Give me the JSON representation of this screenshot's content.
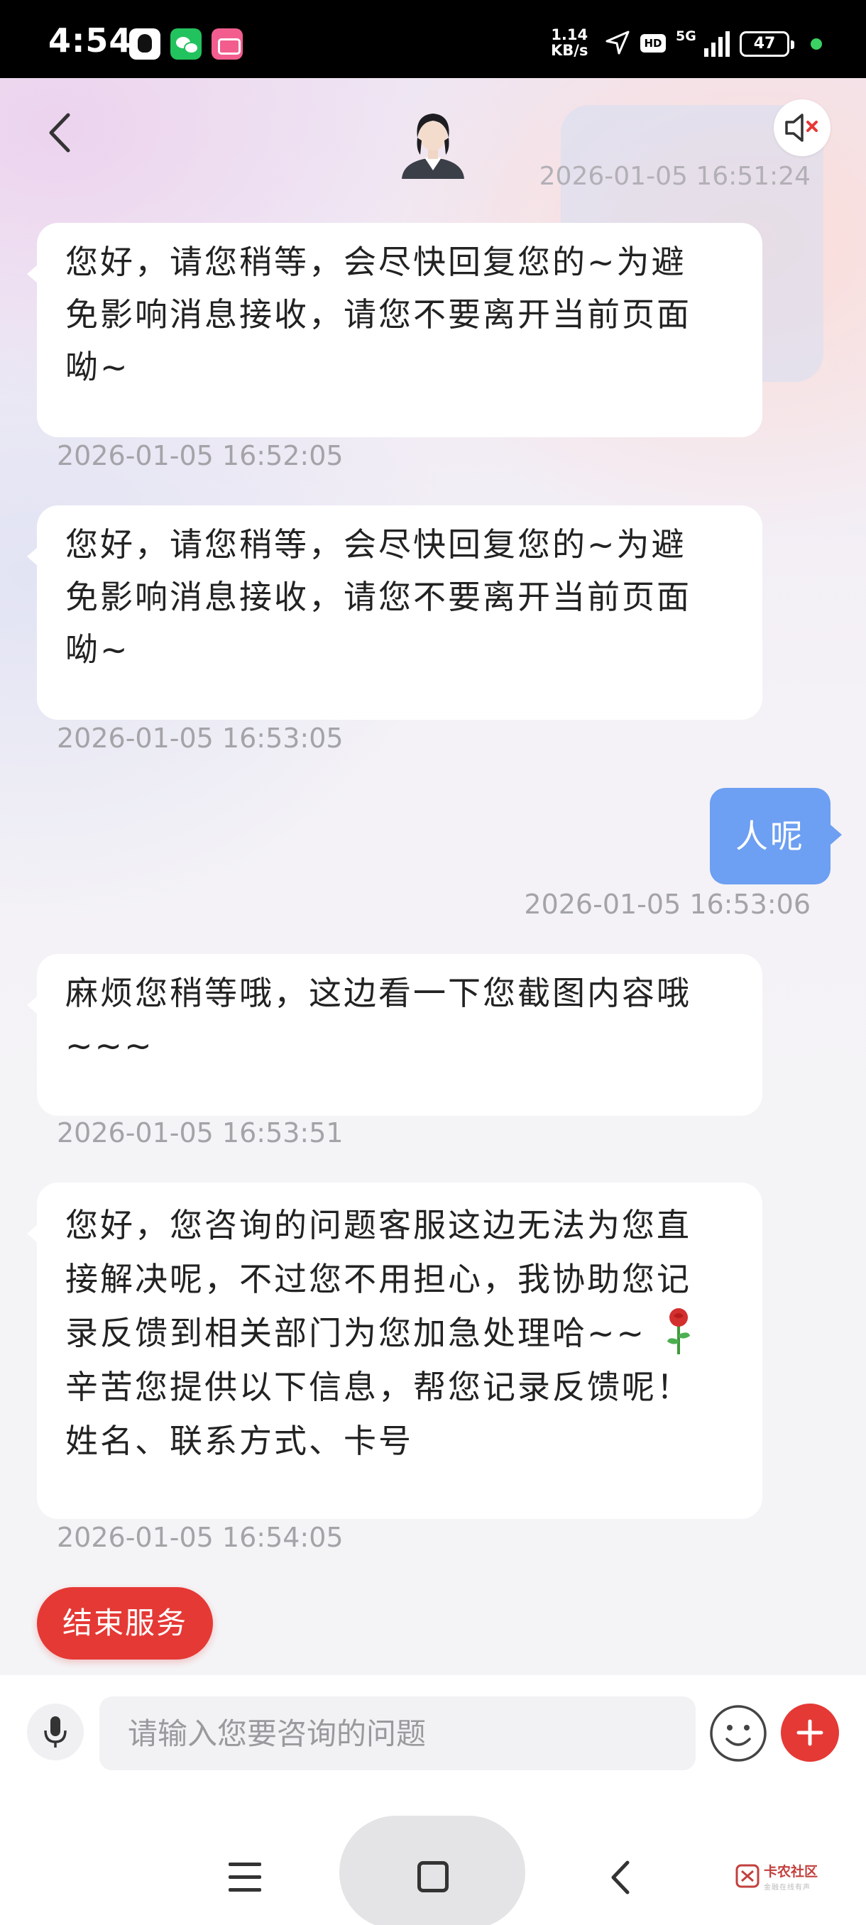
{
  "status_bar": {
    "time": "4:54",
    "speed_value": "1.14",
    "speed_unit": "KB/s",
    "hd_label": "HD",
    "network": "5G",
    "battery": "47",
    "app_icons": [
      "qq-icon",
      "wechat-icon",
      "bilibili-icon"
    ]
  },
  "header": {
    "previous_timestamp": "2026-01-05 16:51:24"
  },
  "messages": [
    {
      "side": "left",
      "lines": [
        "您好，请您稍等，会尽快回复您的~为避",
        "免影响消息接收，请您不要离开当前页面",
        "呦~"
      ],
      "timestamp": "2026-01-05 16:52:05"
    },
    {
      "side": "left",
      "lines": [
        "您好，请您稍等，会尽快回复您的~为避",
        "免影响消息接收，请您不要离开当前页面",
        "呦~"
      ],
      "timestamp": "2026-01-05 16:53:05"
    },
    {
      "side": "right",
      "text": "人呢",
      "timestamp": "2026-01-05 16:53:06"
    },
    {
      "side": "left",
      "lines": [
        "麻烦您稍等哦，这边看一下您截图内容哦",
        "~~~"
      ],
      "timestamp": "2026-01-05 16:53:51"
    },
    {
      "side": "left",
      "lines": [
        "您好，您咨询的问题客服这边无法为您直",
        "接解决呢，不过您不用担心，我协助您记",
        "录反馈到相关部门为您加急处理哈~~",
        "辛苦您提供以下信息，帮您记录反馈呢！",
        "姓名、联系方式、卡号"
      ],
      "emoji": "rose-icon",
      "timestamp": "2026-01-05 16:54:05"
    }
  ],
  "end_service_label": "结束服务",
  "input": {
    "placeholder": "请输入您要咨询的问题",
    "value": ""
  },
  "watermark": {
    "title": "卡农社区",
    "subtitle": "金融在线有声"
  },
  "colors": {
    "accent_red": "#e53935",
    "user_bubble": "#6d9ff2",
    "status_green": "#3ad063"
  }
}
